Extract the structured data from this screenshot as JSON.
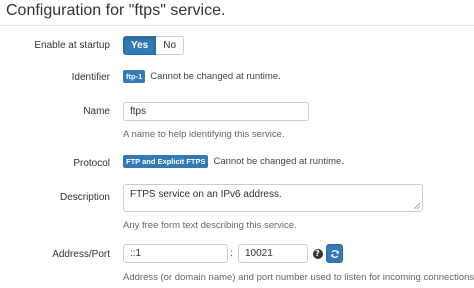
{
  "page": {
    "title": "Configuration for \"ftps\" service."
  },
  "startup": {
    "label": "Enable at startup",
    "yes_label": "Yes",
    "no_label": "No"
  },
  "identifier": {
    "label": "Identifier",
    "badge": "ftp-1",
    "note": "Cannot be changed at runtime."
  },
  "name": {
    "label": "Name",
    "value": "ftps",
    "help": "A name to help identifying this service."
  },
  "protocol": {
    "label": "Protocol",
    "badge": "FTP and Explicit FTPS",
    "note": "Cannot be changed at runtime."
  },
  "description": {
    "label": "Description",
    "value": "FTPS service on an IPv6 address.",
    "help": "Any free form text describing this service."
  },
  "address": {
    "label": "Address/Port",
    "address_value": "::1",
    "separator": ":",
    "port_value": "10021",
    "help_icon_glyph": "?",
    "help": "Address (or domain name) and port number used to listen for incoming connections."
  },
  "colors": {
    "primary": "#337ab7",
    "border": "#cccccc",
    "text": "#333333",
    "muted": "#666666"
  },
  "icons": [
    "question-circle-icon",
    "refresh-icon",
    "resize-grip-icon"
  ]
}
